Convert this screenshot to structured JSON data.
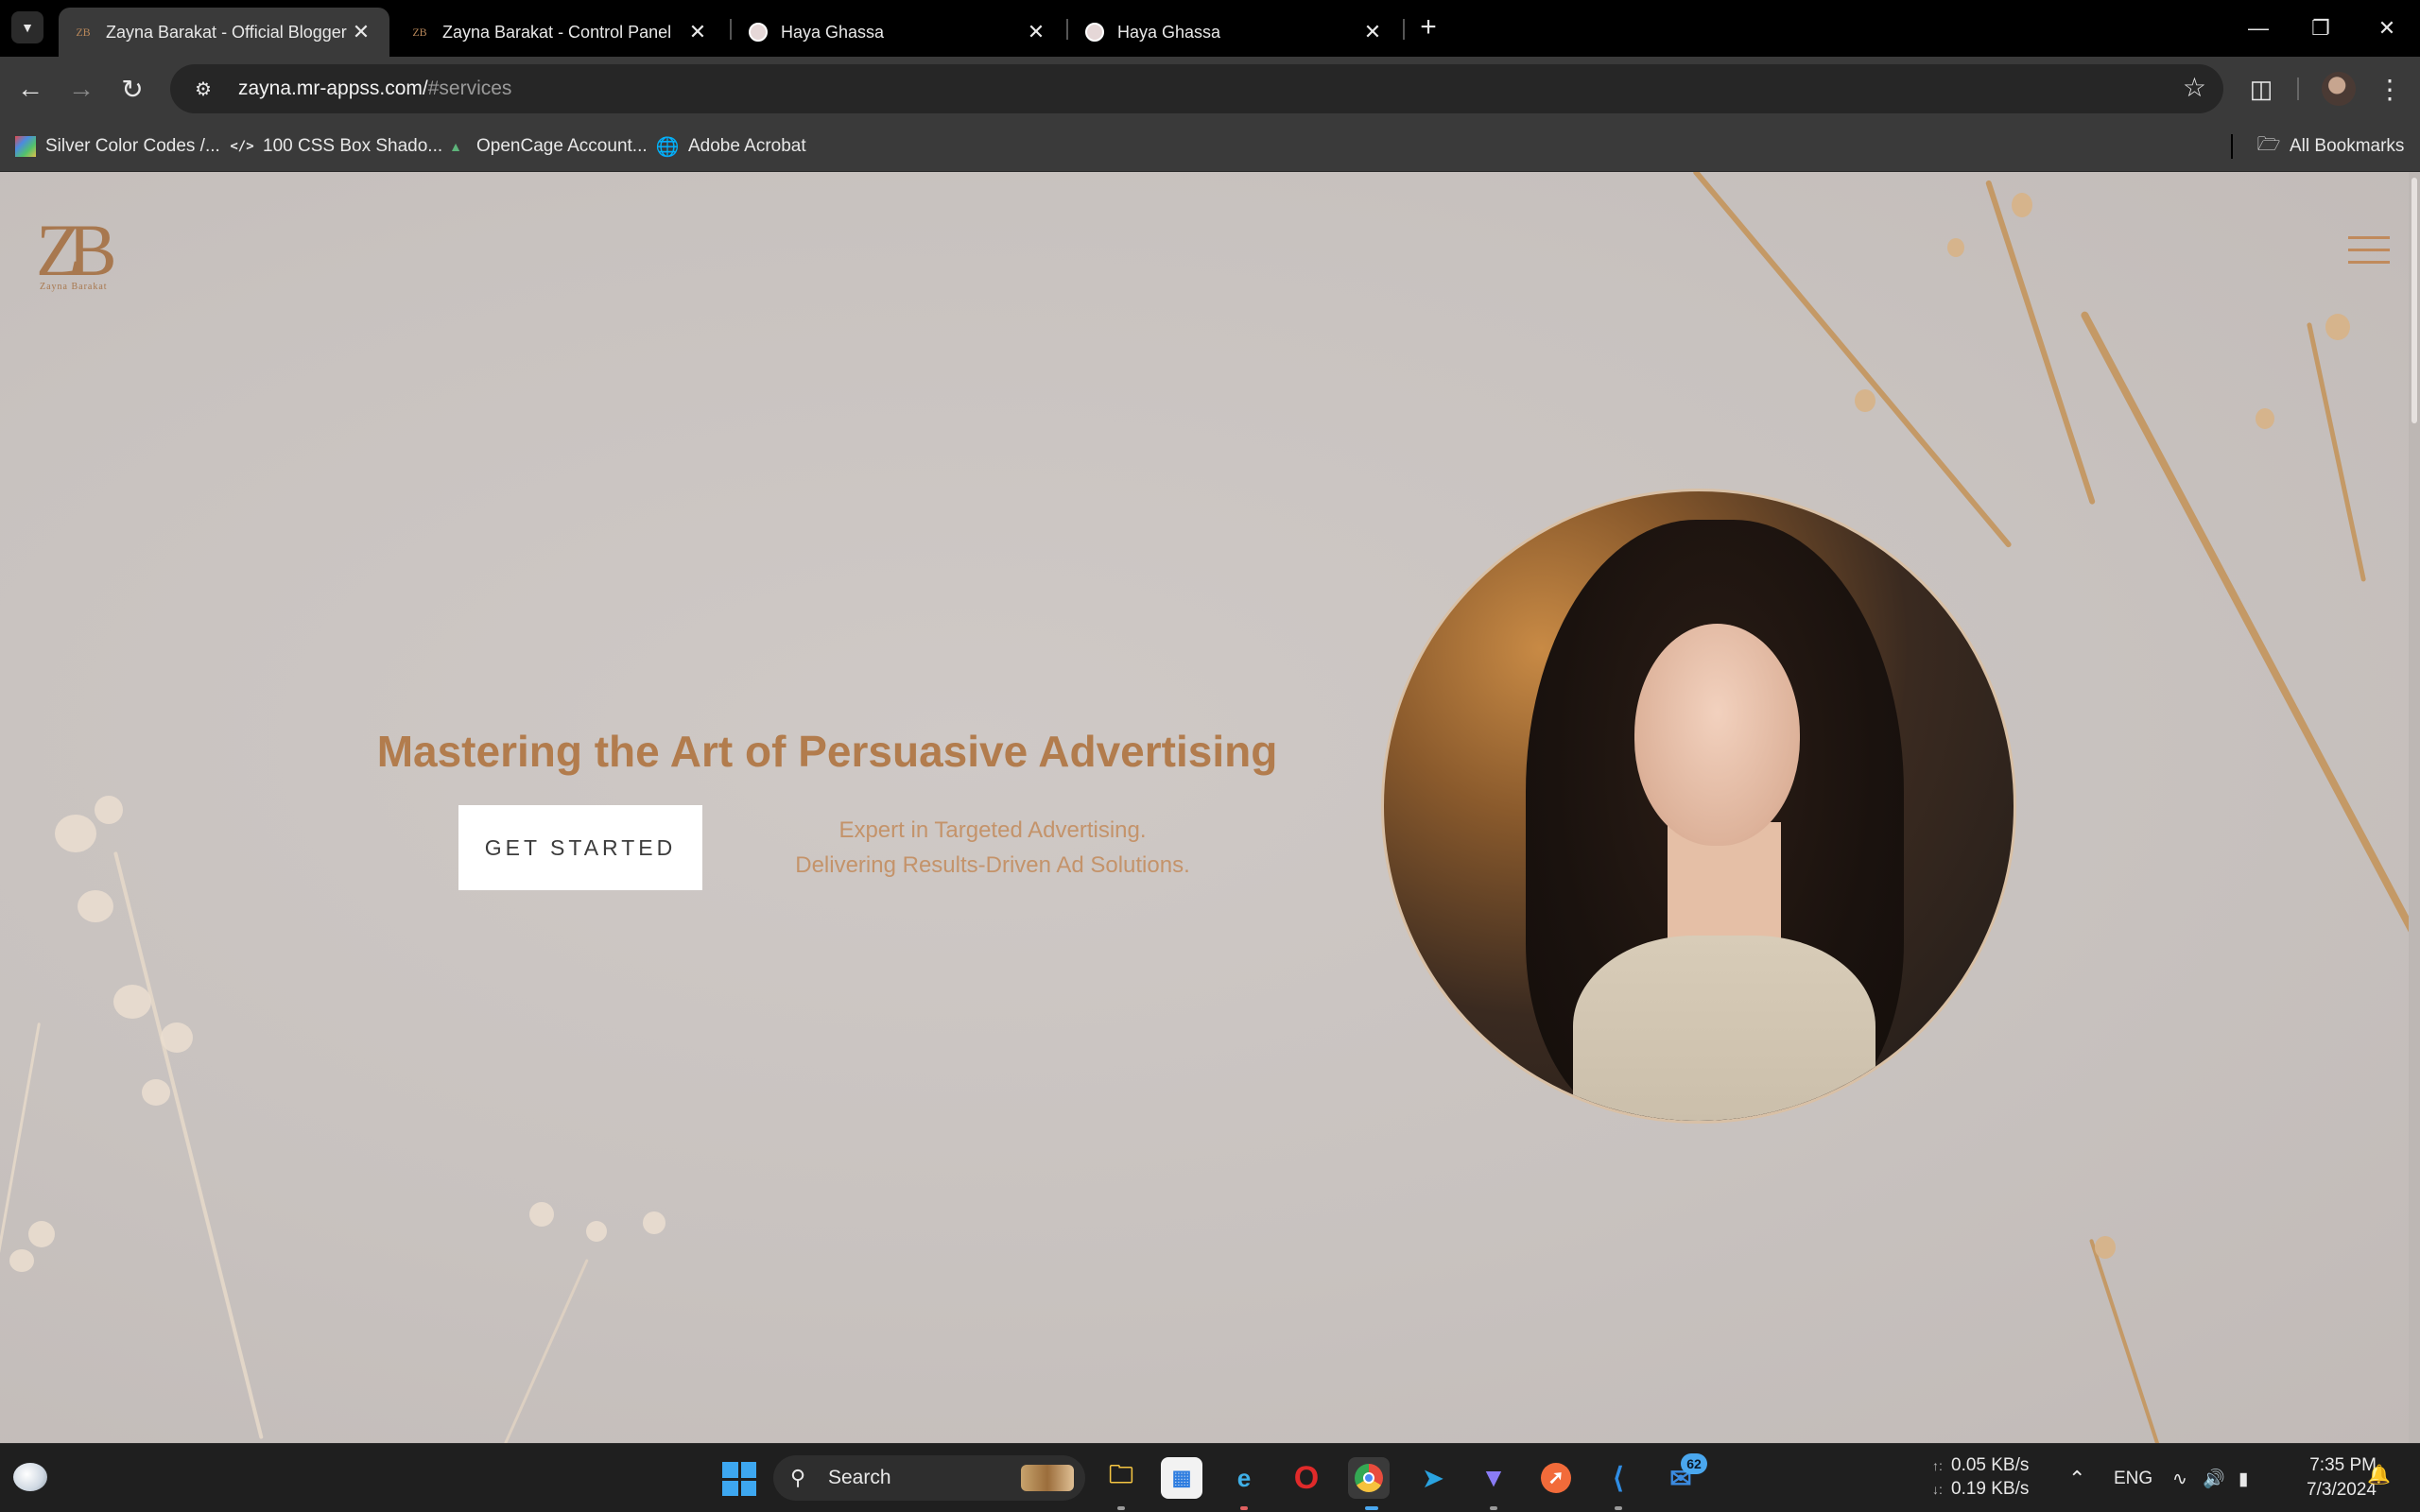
{
  "tabs": [
    {
      "title": "Zayna Barakat - Official Blogger",
      "favicon": "ZB",
      "active": true
    },
    {
      "title": "Zayna Barakat - Control Panel",
      "favicon": "ZB",
      "active": false
    },
    {
      "title": "Haya Ghassa",
      "favicon": "",
      "active": false
    },
    {
      "title": "Haya Ghassa",
      "favicon": "",
      "active": false
    }
  ],
  "address_bar": {
    "domain": "zayna.mr-appss.com/",
    "path": "#services"
  },
  "bookmarks": [
    {
      "label": "Silver Color Codes /...",
      "icon": "palette-icon"
    },
    {
      "label": "100 CSS Box Shado...",
      "icon": "code-icon"
    },
    {
      "label": "OpenCage Account...",
      "icon": "map-icon"
    },
    {
      "label": "Adobe Acrobat",
      "icon": "globe-icon"
    }
  ],
  "all_bookmarks_label": "All Bookmarks",
  "site": {
    "logo_mark": "ZB",
    "logo_sub": "Zayna Barakat",
    "headline": "Mastering the Art of Persuasive Advertising",
    "cta_label": "GET STARTED",
    "tagline_1": "Expert in Targeted Advertising.",
    "tagline_2": "Delivering Results-Driven Ad Solutions."
  },
  "taskbar": {
    "search_placeholder": "Search",
    "badge_count": "62",
    "upload_speed": "0.05 KB/s",
    "download_speed": "0.19 KB/s",
    "language": "ENG",
    "time": "7:35 PM",
    "date": "7/3/2024"
  },
  "colors": {
    "accent": "#b27c4d",
    "page_bg": "#cac4c1",
    "chrome_bg": "#3a3a3a"
  }
}
